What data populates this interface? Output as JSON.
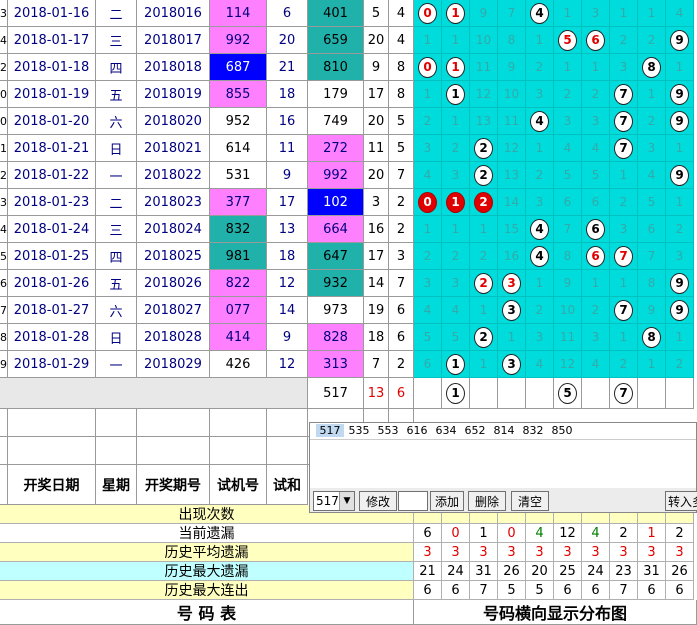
{
  "colors": {
    "blue_bg": "#0000ff",
    "magenta": "#ff80ff",
    "teal": "#20b2aa",
    "cyan_dist": "#00dcdc",
    "yellow_header": "#ffffc0"
  },
  "rows": [
    {
      "pre": "3",
      "date": "2018-01-16",
      "week": "二",
      "issue": "2018016",
      "test": "114",
      "testbg": "m",
      "tr": "6",
      "num": "401",
      "numbg": "t",
      "sum": "5",
      "span": "4",
      "d": [
        "0",
        "1",
        "9",
        "7",
        "4",
        "1",
        "3",
        "1",
        "1",
        "4"
      ],
      "ball": [
        "wr",
        "wr",
        "",
        "",
        "w",
        "",
        "",
        "",
        "",
        ""
      ]
    },
    {
      "pre": "4",
      "date": "2018-01-17",
      "week": "三",
      "issue": "2018017",
      "test": "992",
      "testbg": "m",
      "tr": "20",
      "num": "659",
      "numbg": "t",
      "sum": "20",
      "span": "4",
      "d": [
        "1",
        "1",
        "10",
        "8",
        "1",
        "5",
        "6",
        "2",
        "2",
        "9"
      ],
      "ball": [
        "",
        "",
        "",
        "",
        "",
        "wr",
        "wr",
        "",
        "",
        "w"
      ]
    },
    {
      "pre": "2",
      "date": "2018-01-18",
      "week": "四",
      "issue": "2018018",
      "test": "687",
      "testbg": "b",
      "tr": "21",
      "num": "810",
      "numbg": "t",
      "sum": "9",
      "span": "8",
      "d": [
        "0",
        "1",
        "11",
        "9",
        "2",
        "1",
        "1",
        "3",
        "8",
        "1"
      ],
      "ball": [
        "wr",
        "wr",
        "",
        "",
        "",
        "",
        "",
        "",
        "w",
        ""
      ]
    },
    {
      "pre": "0",
      "date": "2018-01-19",
      "week": "五",
      "issue": "2018019",
      "test": "855",
      "testbg": "m",
      "tr": "18",
      "num": "179",
      "numbg": "",
      "sum": "17",
      "span": "8",
      "d": [
        "1",
        "1",
        "12",
        "10",
        "3",
        "2",
        "2",
        "7",
        "1",
        "9"
      ],
      "ball": [
        "",
        "w",
        "",
        "",
        "",
        "",
        "",
        "w",
        "",
        "w"
      ]
    },
    {
      "pre": "0",
      "date": "2018-01-20",
      "week": "六",
      "issue": "2018020",
      "test": "952",
      "testbg": "",
      "tr": "16",
      "num": "749",
      "numbg": "",
      "sum": "20",
      "span": "5",
      "d": [
        "2",
        "1",
        "13",
        "11",
        "4",
        "3",
        "3",
        "7",
        "2",
        "9"
      ],
      "ball": [
        "",
        "",
        "",
        "",
        "w",
        "",
        "",
        "w",
        "",
        "w"
      ]
    },
    {
      "pre": "1",
      "date": "2018-01-21",
      "week": "日",
      "issue": "2018021",
      "test": "614",
      "testbg": "",
      "tr": "11",
      "num": "272",
      "numbg": "m",
      "sum": "11",
      "span": "5",
      "d": [
        "3",
        "2",
        "2",
        "12",
        "1",
        "4",
        "4",
        "7",
        "3",
        "1"
      ],
      "ball": [
        "",
        "",
        "w",
        "",
        "",
        "",
        "",
        "w",
        "",
        ""
      ]
    },
    {
      "pre": "2",
      "date": "2018-01-22",
      "week": "一",
      "issue": "2018022",
      "test": "531",
      "testbg": "",
      "tr": "9",
      "num": "992",
      "numbg": "m",
      "sum": "20",
      "span": "7",
      "d": [
        "4",
        "3",
        "2",
        "13",
        "2",
        "5",
        "5",
        "1",
        "4",
        "9"
      ],
      "ball": [
        "",
        "",
        "w",
        "",
        "",
        "",
        "",
        "",
        "",
        "w"
      ]
    },
    {
      "pre": "3",
      "date": "2018-01-23",
      "week": "二",
      "issue": "2018023",
      "test": "377",
      "testbg": "m",
      "tr": "17",
      "num": "102",
      "numbg": "b",
      "sum": "3",
      "span": "2",
      "d": [
        "0",
        "1",
        "2",
        "14",
        "3",
        "6",
        "6",
        "2",
        "5",
        "1"
      ],
      "ball": [
        "r",
        "r",
        "r",
        "",
        "",
        "",
        "",
        "",
        "",
        ""
      ]
    },
    {
      "pre": "4",
      "date": "2018-01-24",
      "week": "三",
      "issue": "2018024",
      "test": "832",
      "testbg": "t",
      "tr": "13",
      "num": "664",
      "numbg": "m",
      "sum": "16",
      "span": "2",
      "d": [
        "1",
        "1",
        "1",
        "15",
        "4",
        "7",
        "6",
        "3",
        "6",
        "2"
      ],
      "ball": [
        "",
        "",
        "",
        "",
        "w",
        "",
        "w",
        "",
        "",
        ""
      ]
    },
    {
      "pre": "5",
      "date": "2018-01-25",
      "week": "四",
      "issue": "2018025",
      "test": "981",
      "testbg": "t",
      "tr": "18",
      "num": "647",
      "numbg": "t",
      "sum": "17",
      "span": "3",
      "d": [
        "2",
        "2",
        "2",
        "16",
        "4",
        "8",
        "6",
        "7",
        "7",
        "3"
      ],
      "ball": [
        "",
        "",
        "",
        "",
        "w",
        "",
        "wr",
        "wr",
        "",
        ""
      ]
    },
    {
      "pre": "6",
      "date": "2018-01-26",
      "week": "五",
      "issue": "2018026",
      "test": "822",
      "testbg": "m",
      "tr": "12",
      "num": "932",
      "numbg": "t",
      "sum": "14",
      "span": "7",
      "d": [
        "3",
        "3",
        "2",
        "3",
        "1",
        "9",
        "1",
        "1",
        "8",
        "9"
      ],
      "ball": [
        "",
        "",
        "wr",
        "wr",
        "",
        "",
        "",
        "",
        "",
        "w"
      ]
    },
    {
      "pre": "7",
      "date": "2018-01-27",
      "week": "六",
      "issue": "2018027",
      "test": "077",
      "testbg": "m",
      "tr": "14",
      "num": "973",
      "numbg": "",
      "sum": "19",
      "span": "6",
      "d": [
        "4",
        "4",
        "1",
        "3",
        "2",
        "10",
        "2",
        "7",
        "9",
        "9"
      ],
      "ball": [
        "",
        "",
        "",
        "w",
        "",
        "",
        "",
        "w",
        "",
        "w"
      ]
    },
    {
      "pre": "8",
      "date": "2018-01-28",
      "week": "日",
      "issue": "2018028",
      "test": "414",
      "testbg": "m",
      "tr": "9",
      "num": "828",
      "numbg": "m",
      "sum": "18",
      "span": "6",
      "d": [
        "5",
        "5",
        "2",
        "1",
        "3",
        "11",
        "3",
        "1",
        "8",
        "1"
      ],
      "ball": [
        "",
        "",
        "w",
        "",
        "",
        "",
        "",
        "",
        "w",
        ""
      ]
    },
    {
      "pre": "9",
      "date": "2018-01-29",
      "week": "一",
      "issue": "2018029",
      "test": "426",
      "testbg": "",
      "tr": "12",
      "num": "313",
      "numbg": "m",
      "sum": "7",
      "span": "2",
      "d": [
        "6",
        "1",
        "1",
        "3",
        "4",
        "12",
        "4",
        "2",
        "1",
        "2"
      ],
      "ball": [
        "",
        "w",
        "",
        "w",
        "",
        "",
        "",
        "",
        "",
        ""
      ]
    }
  ],
  "pending": {
    "num": "517",
    "sum": "13",
    "span": "6",
    "balls": [
      "",
      "1",
      "",
      "",
      "",
      "5",
      "",
      "7",
      "",
      ""
    ]
  },
  "editor": {
    "list": [
      "517",
      "535",
      "553",
      "616",
      "634",
      "652",
      "814",
      "832",
      "850"
    ],
    "select_value": "517",
    "modify": "修改",
    "add": "添加",
    "delete": "删除",
    "clear": "清空",
    "import": "转入多"
  },
  "headers": {
    "date": "开奖日期",
    "week": "星期",
    "issue": "开奖期号",
    "test": "试机号",
    "testsum": "试和"
  },
  "stats": [
    {
      "label": "出现次数",
      "values": [
        "",
        "",
        "",
        "",
        "",
        "",
        "",
        "",
        "",
        ""
      ]
    },
    {
      "label": "当前遗漏",
      "values": [
        "6",
        "0",
        "1",
        "0",
        "4",
        "12",
        "4",
        "2",
        "1",
        "2"
      ]
    },
    {
      "label": "历史平均遗漏",
      "values": [
        "3",
        "3",
        "3",
        "3",
        "3",
        "3",
        "3",
        "3",
        "3",
        "3"
      ]
    },
    {
      "label": "历史最大遗漏",
      "values": [
        "21",
        "24",
        "31",
        "26",
        "20",
        "25",
        "24",
        "23",
        "31",
        "26"
      ]
    },
    {
      "label": "历史最大连出",
      "values": [
        "6",
        "6",
        "7",
        "5",
        "5",
        "6",
        "6",
        "7",
        "6",
        "6"
      ]
    }
  ],
  "footer": {
    "left": "号  码  表",
    "right": "号码横向显示分布图"
  }
}
